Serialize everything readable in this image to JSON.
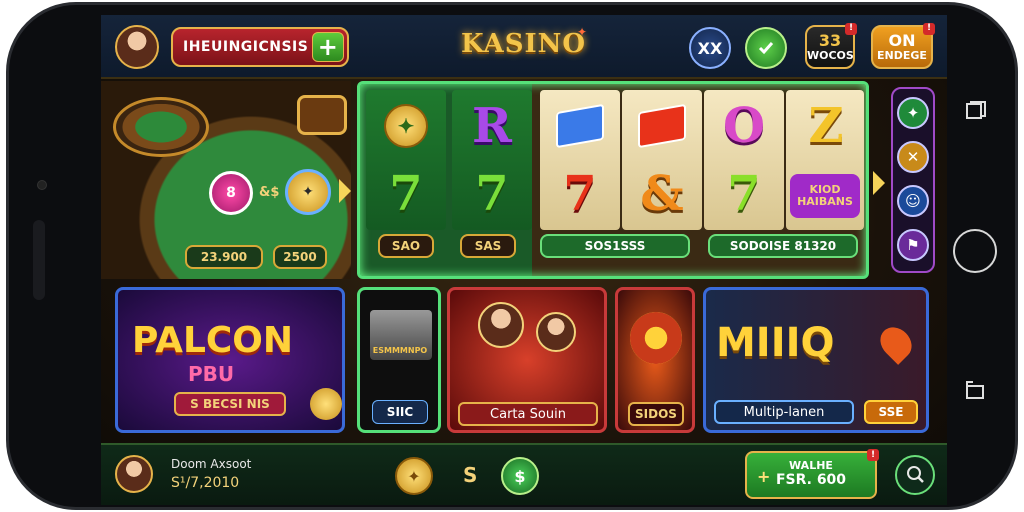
{
  "header": {
    "balance_text": "IHEUINGICNSIS",
    "plus_label": "+",
    "logo": "KASINO",
    "icon_a": "XX",
    "badge_a_top": "33",
    "badge_a_bottom": "WOCOS",
    "badge_b_top": "ON",
    "badge_b_bottom": "ENDEGE"
  },
  "table": {
    "chip_a": "8",
    "chip_sep": "&$",
    "bet_left": "23.900",
    "bet_right": "2500"
  },
  "slot_left": {
    "reel1_bottom": "7",
    "reel2_top": "R",
    "reel2_bottom": "7",
    "pill_left": "SAO",
    "pill_right": "SAS"
  },
  "slot_right": {
    "reel_c_top": "O",
    "reel_d_top": "Z",
    "reel_a_bottom": "7",
    "reel_b_bottom": "&",
    "reel_c_bottom": "7",
    "banner": "KIOD HAIBANS",
    "pill_left": "SOS1SSS",
    "pill_right": "SODOISE 81320"
  },
  "cards": {
    "c1_title": "PALCON",
    "c1_sub": "PBU",
    "c1_pill": "S BECSI NIS",
    "c2_title": "ESMMMNPO",
    "c2_pill": "SIIC",
    "c3_pill": "Carta Souin",
    "c4_pill": "SIDOS",
    "c5_title": "MIIIQ",
    "c5_pill": "Multip-lanen",
    "c5_pill_right": "SSE"
  },
  "footer": {
    "user_name": "Doom Axsoot",
    "user_balance": "S¹/7,2010",
    "center_mark": "S",
    "wallet_title": "WALHE",
    "wallet_amount": "FSR. 600",
    "wallet_icon": "+"
  },
  "icons": {
    "top_icon_a": "x-icon",
    "top_icon_b": "green-check-icon",
    "rail": [
      "plus-star-icon",
      "close-icon",
      "user-icon",
      "flag-icon"
    ],
    "footer": [
      "coin-icon",
      "dollar-icon",
      "search-icon"
    ]
  },
  "colors": {
    "accent_gold": "#e6b34a",
    "slot_green": "#56e07a",
    "rail_purple": "#a04ac8",
    "card_blue": "#3a6ad8"
  }
}
